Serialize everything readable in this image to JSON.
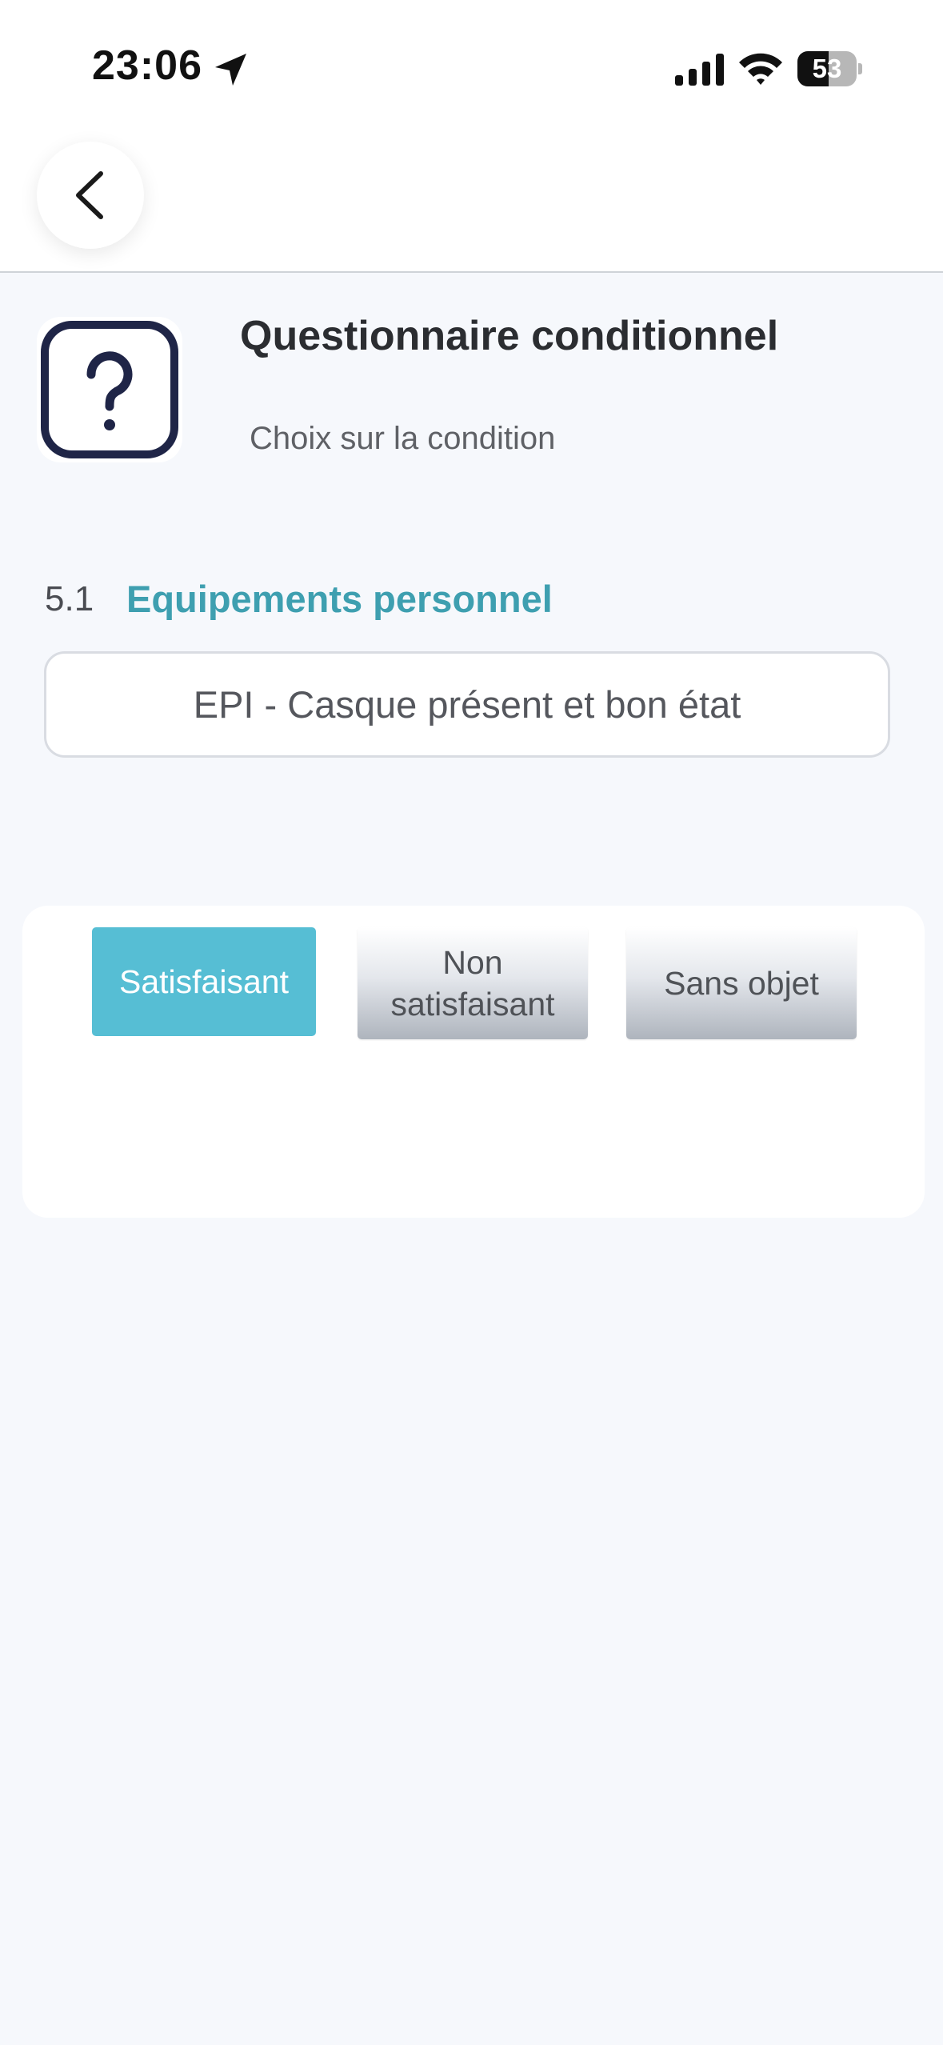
{
  "status_bar": {
    "time": "23:06",
    "battery_level": "53",
    "battery_fraction": 0.53,
    "icons": [
      "location-arrow-icon",
      "cellular-signal-icon",
      "wifi-icon",
      "battery-icon"
    ]
  },
  "nav": {
    "back_icon": "chevron-left-icon"
  },
  "header": {
    "icon": "question-mark-icon",
    "title": "Questionnaire conditionnel",
    "subtitle": "Choix sur la condition"
  },
  "section": {
    "number": "5.1",
    "title": "Equipements personnel",
    "accent_color": "#3e9fb0"
  },
  "question": {
    "text": "EPI - Casque présent et bon état"
  },
  "answers": {
    "options": [
      "Satisfaisant",
      "Non satisfaisant",
      "Sans objet"
    ],
    "selected": "Satisfaisant",
    "selected_color": "#56bed4"
  }
}
